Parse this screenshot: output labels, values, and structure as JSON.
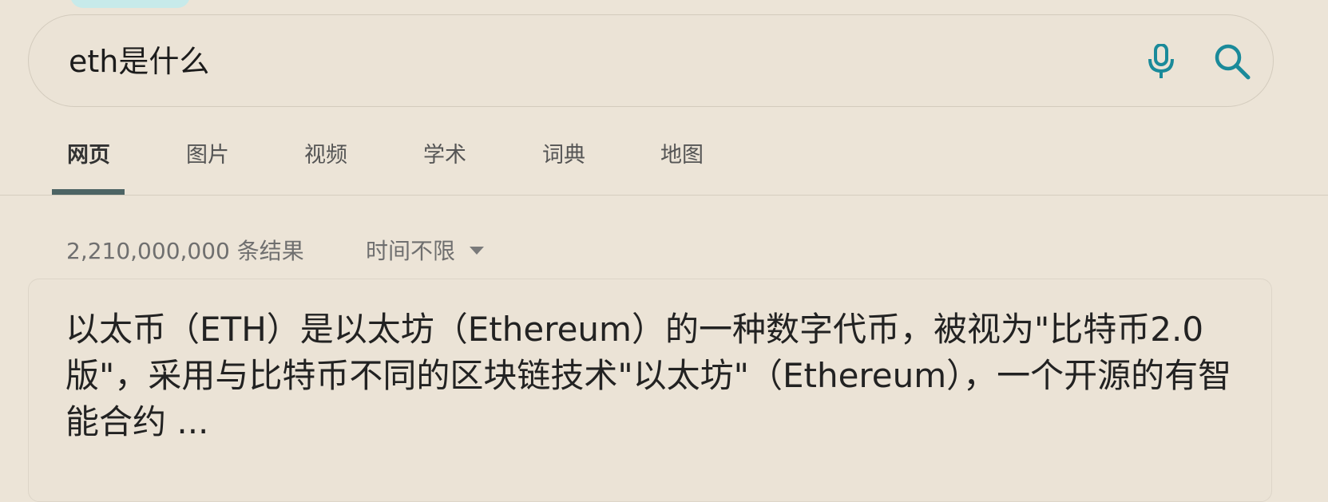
{
  "search": {
    "query": "eth是什么",
    "mic_icon": "microphone-icon",
    "search_icon": "search-icon",
    "accent_color": "#1a8a9a"
  },
  "tabs": [
    {
      "label": "网页",
      "active": true
    },
    {
      "label": "图片",
      "active": false
    },
    {
      "label": "视频",
      "active": false
    },
    {
      "label": "学术",
      "active": false
    },
    {
      "label": "词典",
      "active": false
    },
    {
      "label": "地图",
      "active": false
    }
  ],
  "results": {
    "count_text": "2,210,000,000 条结果",
    "time_filter_label": "时间不限"
  },
  "answer": {
    "text": "以太币（ETH）是以太坊（Ethereum）的一种数字代币，被视为\"比特币2.0版\"，采用与比特币不同的区块链技术\"以太坊\"（Ethereum），一个开源的有智能合约 ..."
  }
}
